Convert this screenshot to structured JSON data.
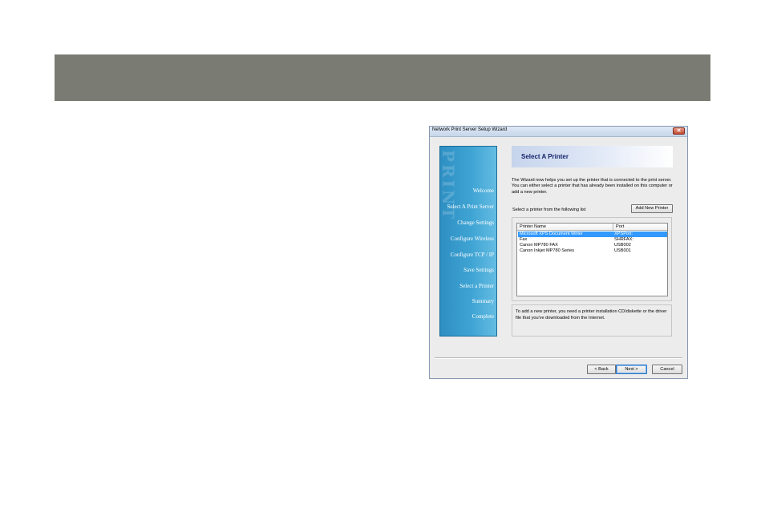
{
  "window": {
    "title": "Network Print Server Setup Wizard",
    "close_glyph": "✕"
  },
  "sidebar": {
    "watermark": "PRINT",
    "items": [
      {
        "label": "Welcome"
      },
      {
        "label": "Select A Print Server"
      },
      {
        "label": "Change Settings"
      },
      {
        "label": "Configure Wireless"
      },
      {
        "label": "Configure TCP / IP"
      },
      {
        "label": "Save Settings"
      },
      {
        "label": "Select a Printer",
        "active": true
      },
      {
        "label": "Summary"
      },
      {
        "label": "Complete"
      }
    ]
  },
  "header": {
    "title": "Select A Printer"
  },
  "intro_text": "The Wizard now helps you set up the printer that is connected to the print server. You can either select a printer that has already been installed on this computer or add a new printer.",
  "list_prompt": "Select a printer from the following list",
  "add_printer_button": "Add New Printer",
  "printer_table": {
    "columns": [
      "Printer Name",
      "Port"
    ],
    "rows": [
      {
        "name": "Microsoft XPS Document Writer",
        "port": "XPSPort:",
        "selected": true
      },
      {
        "name": "Fax",
        "port": "SHRFAX:"
      },
      {
        "name": "Canon MP780 FAX",
        "port": "USB002"
      },
      {
        "name": "Canon Inkjet MP780 Series",
        "port": "USB001"
      }
    ]
  },
  "note_text": "To add a new printer, you need a printer installation CD/diskette or the driver file that you've downloaded from the Internet.",
  "buttons": {
    "back": "< Back",
    "next": "Next >",
    "cancel": "Cancel"
  },
  "colors": {
    "banner": "#7a7b72",
    "selection": "#3399ff",
    "header_title": "#16246b"
  }
}
